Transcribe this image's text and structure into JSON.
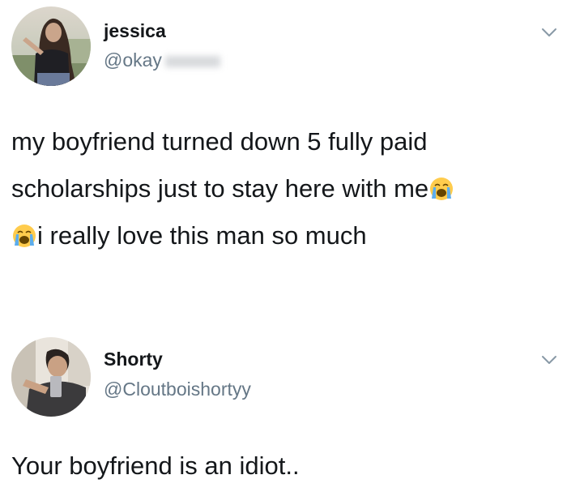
{
  "tweets": [
    {
      "display_name": "jessica",
      "handle": "@okay",
      "handle_redacted": true,
      "avatar_icon": "user-avatar-woman",
      "menu_icon": "chevron-down-icon",
      "text_lines": [
        {
          "text": "my boyfriend turned down 5 fully paid",
          "emoji_after": null,
          "emoji_before": null
        },
        {
          "text": "scholarships just to stay here with me",
          "emoji_after": "loudly-crying-face",
          "emoji_before": null
        },
        {
          "text": "i really love this man so much",
          "emoji_after": null,
          "emoji_before": "loudly-crying-face"
        }
      ]
    },
    {
      "display_name": "Shorty",
      "handle": "@Cloutboishortyy",
      "avatar_icon": "user-avatar-man",
      "menu_icon": "chevron-down-icon",
      "text_lines": [
        {
          "text": "Your boyfriend is an idiot.."
        }
      ]
    }
  ],
  "colors": {
    "text": "#14171a",
    "secondary_text": "#657786",
    "background": "#ffffff"
  }
}
